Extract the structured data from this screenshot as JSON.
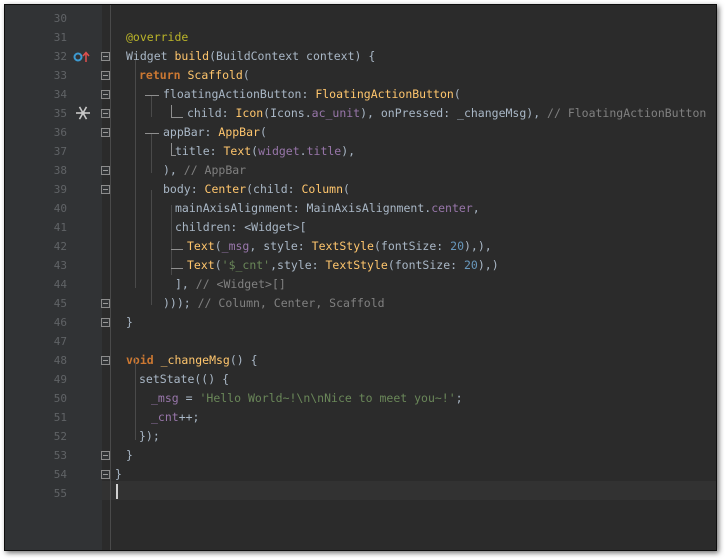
{
  "editor": {
    "current_line": 55,
    "lines": [
      {
        "no": "30",
        "segs": []
      },
      {
        "no": "31",
        "segs": [
          {
            "t": "@override",
            "c": "a"
          }
        ]
      },
      {
        "no": "32",
        "segs": [
          {
            "t": "Widget ",
            "c": ""
          },
          {
            "t": "build",
            "c": "f"
          },
          {
            "t": "(BuildContext context) {",
            "c": ""
          }
        ]
      },
      {
        "no": "33",
        "segs": [
          {
            "t": "return ",
            "c": "k"
          },
          {
            "t": "Scaffold",
            "c": "f"
          },
          {
            "t": "(",
            "c": ""
          }
        ]
      },
      {
        "no": "34",
        "segs": [
          {
            "t": "floatingActionButton: ",
            "c": ""
          },
          {
            "t": "FloatingActionButton",
            "c": "f"
          },
          {
            "t": "(",
            "c": ""
          }
        ]
      },
      {
        "no": "35",
        "segs": [
          {
            "t": "child: ",
            "c": ""
          },
          {
            "t": "Icon",
            "c": "f"
          },
          {
            "t": "(Icons.",
            "c": ""
          },
          {
            "t": "ac_unit",
            "c": "p"
          },
          {
            "t": "), onPressed: _changeMsg), ",
            "c": ""
          },
          {
            "t": "// FloatingActionButton",
            "c": "c"
          }
        ]
      },
      {
        "no": "36",
        "segs": [
          {
            "t": "appBar: ",
            "c": ""
          },
          {
            "t": "AppBar",
            "c": "f"
          },
          {
            "t": "(",
            "c": ""
          }
        ]
      },
      {
        "no": "37",
        "segs": [
          {
            "t": "title: ",
            "c": ""
          },
          {
            "t": "Text",
            "c": "f"
          },
          {
            "t": "(",
            "c": ""
          },
          {
            "t": "widget",
            "c": "p"
          },
          {
            "t": ".",
            "c": ""
          },
          {
            "t": "title",
            "c": "p"
          },
          {
            "t": "),",
            "c": ""
          }
        ]
      },
      {
        "no": "38",
        "segs": [
          {
            "t": "), ",
            "c": ""
          },
          {
            "t": "// AppBar",
            "c": "c"
          }
        ]
      },
      {
        "no": "39",
        "segs": [
          {
            "t": "body: ",
            "c": ""
          },
          {
            "t": "Center",
            "c": "f"
          },
          {
            "t": "(child: ",
            "c": ""
          },
          {
            "t": "Column",
            "c": "f"
          },
          {
            "t": "(",
            "c": ""
          }
        ]
      },
      {
        "no": "40",
        "segs": [
          {
            "t": "mainAxisAlignment: MainAxisAlignment.",
            "c": ""
          },
          {
            "t": "center",
            "c": "p"
          },
          {
            "t": ",",
            "c": ""
          }
        ]
      },
      {
        "no": "41",
        "segs": [
          {
            "t": "children: <Widget>[",
            "c": ""
          }
        ]
      },
      {
        "no": "42",
        "segs": [
          {
            "t": "Text",
            "c": "f"
          },
          {
            "t": "(",
            "c": ""
          },
          {
            "t": "_msg",
            "c": "p"
          },
          {
            "t": ", style: ",
            "c": ""
          },
          {
            "t": "TextStyle",
            "c": "f"
          },
          {
            "t": "(fontSize: ",
            "c": ""
          },
          {
            "t": "20",
            "c": "n"
          },
          {
            "t": "),),",
            "c": ""
          }
        ]
      },
      {
        "no": "43",
        "segs": [
          {
            "t": "Text",
            "c": "f"
          },
          {
            "t": "(",
            "c": ""
          },
          {
            "t": "'$_cnt'",
            "c": "s"
          },
          {
            "t": ",style: ",
            "c": ""
          },
          {
            "t": "TextStyle",
            "c": "f"
          },
          {
            "t": "(fontSize: ",
            "c": ""
          },
          {
            "t": "20",
            "c": "n"
          },
          {
            "t": "),)",
            "c": ""
          }
        ]
      },
      {
        "no": "44",
        "segs": [
          {
            "t": "], ",
            "c": ""
          },
          {
            "t": "// <Widget>[]",
            "c": "c"
          }
        ]
      },
      {
        "no": "45",
        "segs": [
          {
            "t": "))); ",
            "c": ""
          },
          {
            "t": "// Column, Center, Scaffold",
            "c": "c"
          }
        ]
      },
      {
        "no": "46",
        "segs": [
          {
            "t": "}",
            "c": ""
          }
        ]
      },
      {
        "no": "47",
        "segs": []
      },
      {
        "no": "48",
        "segs": [
          {
            "t": "void ",
            "c": "k"
          },
          {
            "t": "_changeMsg",
            "c": "f"
          },
          {
            "t": "() {",
            "c": ""
          }
        ]
      },
      {
        "no": "49",
        "segs": [
          {
            "t": "setState(() {",
            "c": ""
          }
        ]
      },
      {
        "no": "50",
        "segs": [
          {
            "t": "_msg",
            "c": "p"
          },
          {
            "t": " = ",
            "c": ""
          },
          {
            "t": "'Hello World~!\\n\\nNice to meet you~!'",
            "c": "s"
          },
          {
            "t": ";",
            "c": ""
          }
        ]
      },
      {
        "no": "51",
        "segs": [
          {
            "t": "_cnt",
            "c": "p"
          },
          {
            "t": "++;",
            "c": ""
          }
        ]
      },
      {
        "no": "52",
        "segs": [
          {
            "t": "});",
            "c": ""
          }
        ]
      },
      {
        "no": "53",
        "segs": [
          {
            "t": "}",
            "c": ""
          }
        ]
      },
      {
        "no": "54",
        "segs": [
          {
            "t": "}",
            "c": ""
          }
        ]
      },
      {
        "no": "55",
        "segs": []
      }
    ]
  },
  "gutter_icons": {
    "override_marker": "override-marker-icon",
    "preview_icon": "snowflake-icon"
  },
  "colors": {
    "background": "#2b2b2b",
    "gutter": "#313335",
    "keyword": "#cc7832",
    "function": "#ffc66d",
    "string": "#6a8759",
    "number": "#6897bb",
    "comment": "#808080",
    "annotation": "#bbb529",
    "field": "#9876aa"
  }
}
